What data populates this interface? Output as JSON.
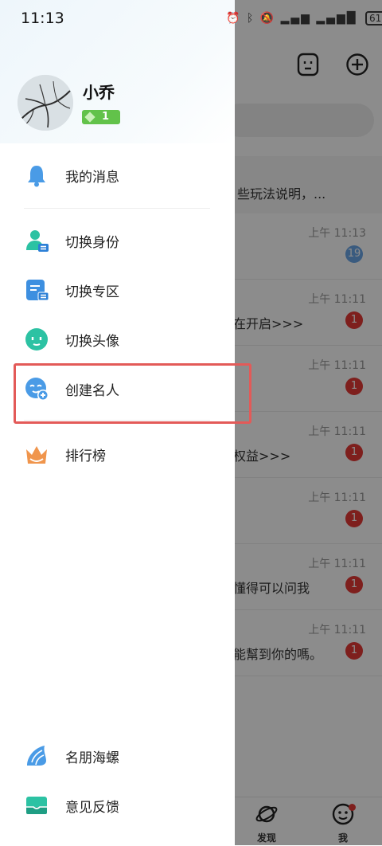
{
  "status_bar": {
    "time": "11:13",
    "icons": [
      "alarm-icon",
      "bluetooth-icon",
      "mute-icon",
      "signal-icon",
      "signal-icon"
    ],
    "battery": "61"
  },
  "background": {
    "notice_text": "些玩法说明，...",
    "chats": [
      {
        "time": "上午 11:13",
        "preview": "",
        "badge": "19",
        "badge_color": "#6aa6e8"
      },
      {
        "time": "上午 11:11",
        "preview": "在开启>>>",
        "badge": "1",
        "badge_color": "#e53935"
      },
      {
        "time": "上午 11:11",
        "preview": "",
        "badge": "1",
        "badge_color": "#e53935"
      },
      {
        "time": "上午 11:11",
        "preview": "权益>>>",
        "badge": "1",
        "badge_color": "#e53935"
      },
      {
        "time": "上午 11:11",
        "preview": "",
        "badge": "1",
        "badge_color": "#e53935"
      },
      {
        "time": "上午 11:11",
        "preview": "懂得可以问我",
        "badge": "1",
        "badge_color": "#e53935"
      },
      {
        "time": "上午 11:11",
        "preview": "能幫到你的嗎。",
        "badge": "1",
        "badge_color": "#e53935"
      }
    ],
    "tabs": [
      {
        "label": "发现",
        "icon": "planet-icon"
      },
      {
        "label": "我",
        "icon": "robot-face-icon"
      }
    ]
  },
  "drawer": {
    "user": {
      "name": "小乔",
      "level": "1"
    },
    "menu": [
      {
        "label": "我的消息",
        "icon": "bell-icon"
      },
      {
        "label": "切换身份",
        "icon": "switch-user-icon"
      },
      {
        "label": "切换专区",
        "icon": "switch-zone-icon"
      },
      {
        "label": "切换头像",
        "icon": "face-icon"
      },
      {
        "label": "创建名人",
        "icon": "add-face-icon"
      },
      {
        "label": "排行榜",
        "icon": "crown-icon"
      }
    ],
    "bottom_menu": [
      {
        "label": "名朋海螺",
        "icon": "conch-icon"
      },
      {
        "label": "意见反馈",
        "icon": "feedback-icon"
      }
    ]
  },
  "colors": {
    "accent_blue": "#4a9be6",
    "accent_green": "#2cc2a3",
    "highlight": "#e35a58",
    "level_green": "#62c24a"
  }
}
